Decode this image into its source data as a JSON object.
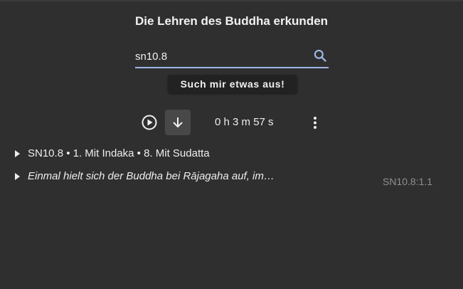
{
  "header": {
    "title": "Die Lehren des Buddha erkunden"
  },
  "search": {
    "value": "sn10.8",
    "icon": "search-icon",
    "accent_color": "#9fb6e6"
  },
  "surprise_button": {
    "label": "Such mir etwas aus!"
  },
  "player": {
    "play_icon": "play-circle-icon",
    "download_icon": "arrow-down-icon",
    "duration": "0 h 3 m 57 s",
    "more_icon": "more-vert-icon"
  },
  "results": [
    {
      "label": "SN10.8 • 1. Mit Indaka • 8. Mit Sudatta"
    },
    {
      "label": "Einmal hielt sich der Buddha bei Rājagaha auf, im…",
      "ref": "SN10.8:1.1"
    }
  ]
}
